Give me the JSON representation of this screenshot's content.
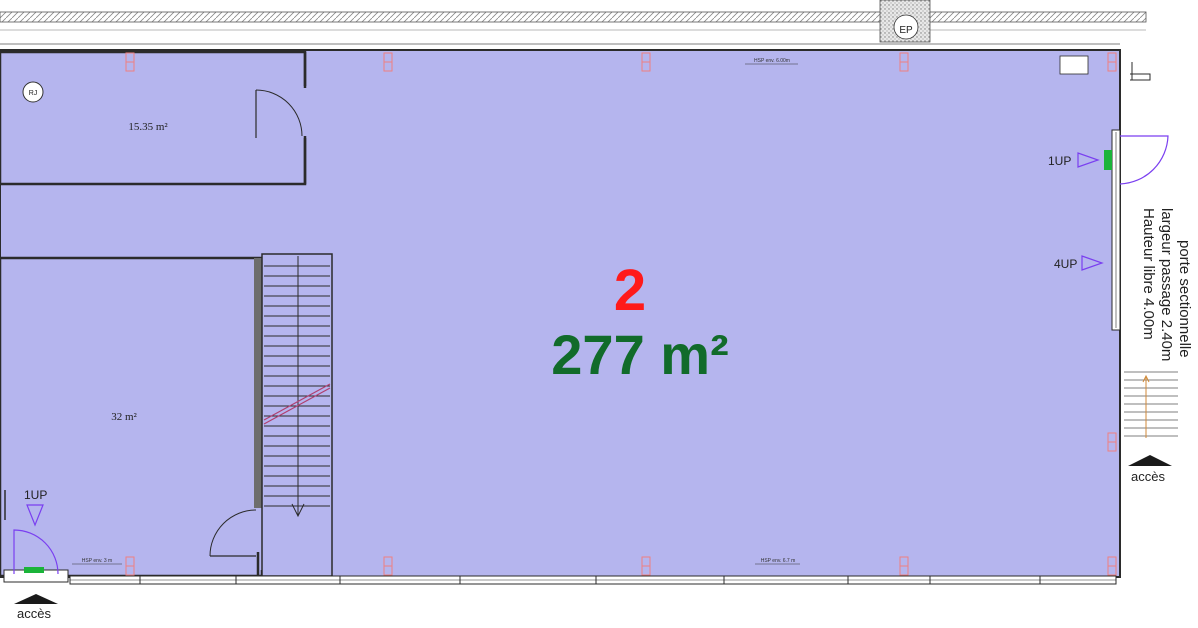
{
  "lot": {
    "number": "2",
    "area": "277 m²",
    "number_color": "#ff1a1a",
    "area_color": "#116b2a"
  },
  "rooms": [
    {
      "id": "office",
      "area": "15.35 m²"
    },
    {
      "id": "room-left",
      "area": "32 m²"
    }
  ],
  "labels": {
    "rj": "RJ",
    "ep": "EP",
    "up_right_top": "1UP",
    "up_right_mid": "4UP",
    "up_left": "1UP",
    "access_bottom_left": "accès",
    "access_right": "accès",
    "hsp_top": "HSP env. 6.00m",
    "hsp_bottom_left": "HSP env. 3 m",
    "hsp_bottom_mid": "HSP env. 6.7 m",
    "door_note": [
      "porte sectionnelle",
      "largeur passage 2.40m",
      "Hauteur libre 4.00m"
    ]
  },
  "colors": {
    "floor": "#b5b5ee",
    "wall": "#2b2b2b",
    "up_marker": "#7a3ff0",
    "exit_sign": "#1bb43a",
    "column": "#f08080"
  }
}
